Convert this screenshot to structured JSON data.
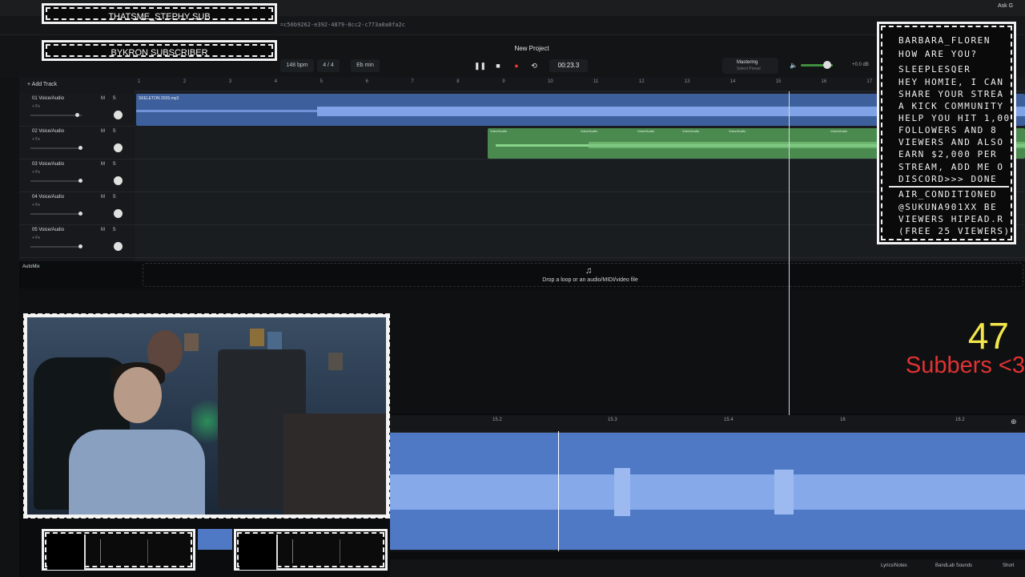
{
  "browser": {
    "url": "=c56b9262-e392-4879-8cc2-c773a0a8fa2c",
    "ask_label": "Ask G"
  },
  "project": {
    "title": "New Project",
    "bpm": "148 bpm",
    "signature": "4 / 4",
    "key": "Eb min",
    "time": "00:23.3",
    "mastering_label": "Mastering",
    "mastering_sub": "Select Preset",
    "output_db": "+0.0 dB"
  },
  "tracklist": {
    "add_track_label": "+ Add Track",
    "tracks": [
      {
        "name": "01 Voice/Audio",
        "fx": "+ Fx",
        "ms": "M S"
      },
      {
        "name": "02 Voice/Audio",
        "fx": "+ Fx",
        "ms": "M S"
      },
      {
        "name": "03 Voice/Audio",
        "fx": "+ Fx",
        "ms": "M S"
      },
      {
        "name": "04 Voice/Audio",
        "fx": "+ Fx",
        "ms": "M S"
      },
      {
        "name": "05 Voice/Audio",
        "fx": "+ Fx",
        "ms": "M S"
      }
    ],
    "automix_label": "AutoMix"
  },
  "ruler": {
    "ticks": [
      "1",
      "2",
      "3",
      "4",
      "5",
      "6",
      "7",
      "8",
      "9",
      "10",
      "11",
      "12",
      "13",
      "14",
      "15",
      "16",
      "17"
    ]
  },
  "clips": {
    "clip1_label": "SKELETON 2026.mp3",
    "clip2_label": "Voice/Audio"
  },
  "dropzone": {
    "icon": "music-note-icon",
    "text": "Drop a loop or an audio/MIDI/video file"
  },
  "editor": {
    "ticks": [
      "15.2",
      "15.3",
      "15.4",
      "16",
      "16.2"
    ]
  },
  "bottombar": {
    "lyrics": "Lyrics/Notes",
    "sounds": "BandLab Sounds",
    "shortcuts": "Short"
  },
  "overlay": {
    "sub_line_1": "THATSME_STEPHY SUB",
    "sub_line_2": "BYKRON SUBSCRIBER",
    "chat": [
      "BARBARA_FLOREN",
      "HOW ARE YOU?",
      "SLEEPLESQER",
      "HEY HOMIE, I CAN",
      "SHARE YOUR STREA",
      "A KICK COMMUNITY",
      "HELP YOU HIT 1,00",
      "FOLLOWERS AND 8",
      "VIEWERS AND ALSO",
      "EARN $2,000 PER",
      "STREAM, ADD ME O",
      "DISCORD>>> DONE",
      "AIR_CONDITIONED",
      "@SUKUNA901XX BE",
      "VIEWERS HIPEAD.R",
      "(FREE 25 VIEWERS)"
    ],
    "sub_count": "47",
    "sub_label": "Subbers <3"
  },
  "colors": {
    "clip_blue": "#4f79c4",
    "clip_green": "#4a8a4e",
    "sub_count": "#f2e64a",
    "sub_label": "#e23232"
  }
}
